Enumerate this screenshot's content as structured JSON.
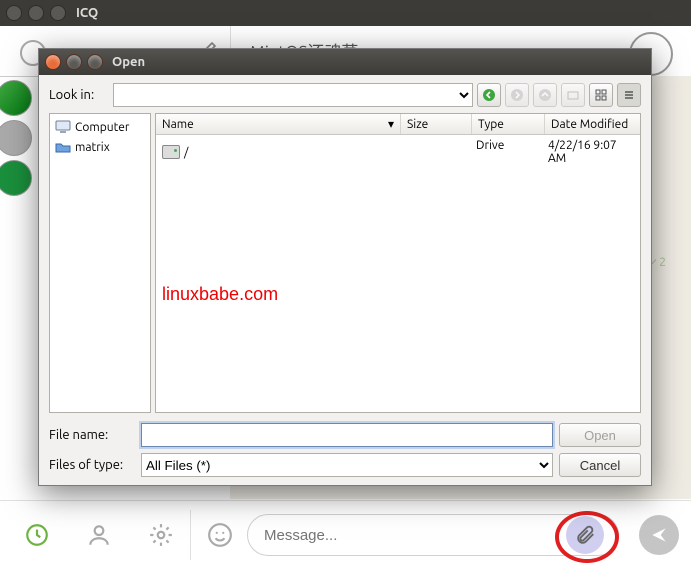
{
  "app": {
    "title": "ICQ"
  },
  "chat": {
    "contact_name": "MintOS还魂草",
    "check_mark": "✓ 2"
  },
  "compose": {
    "placeholder": "Message..."
  },
  "dialog": {
    "title": "Open",
    "look_in_label": "Look in:",
    "look_in_value": "",
    "places": [
      {
        "label": "Computer",
        "kind": "computer"
      },
      {
        "label": "matrix",
        "kind": "folder"
      }
    ],
    "columns": {
      "name": "Name",
      "size": "Size",
      "type": "Type",
      "date": "Date Modified"
    },
    "rows": [
      {
        "name": "/",
        "size": "",
        "type": "Drive",
        "date": "4/22/16 9:07 AM"
      }
    ],
    "filename_label": "File name:",
    "filename_value": "",
    "filter_label": "Files of type:",
    "filter_value": "All Files (*)",
    "open_btn": "Open",
    "cancel_btn": "Cancel"
  },
  "watermark": "linuxbabe.com"
}
